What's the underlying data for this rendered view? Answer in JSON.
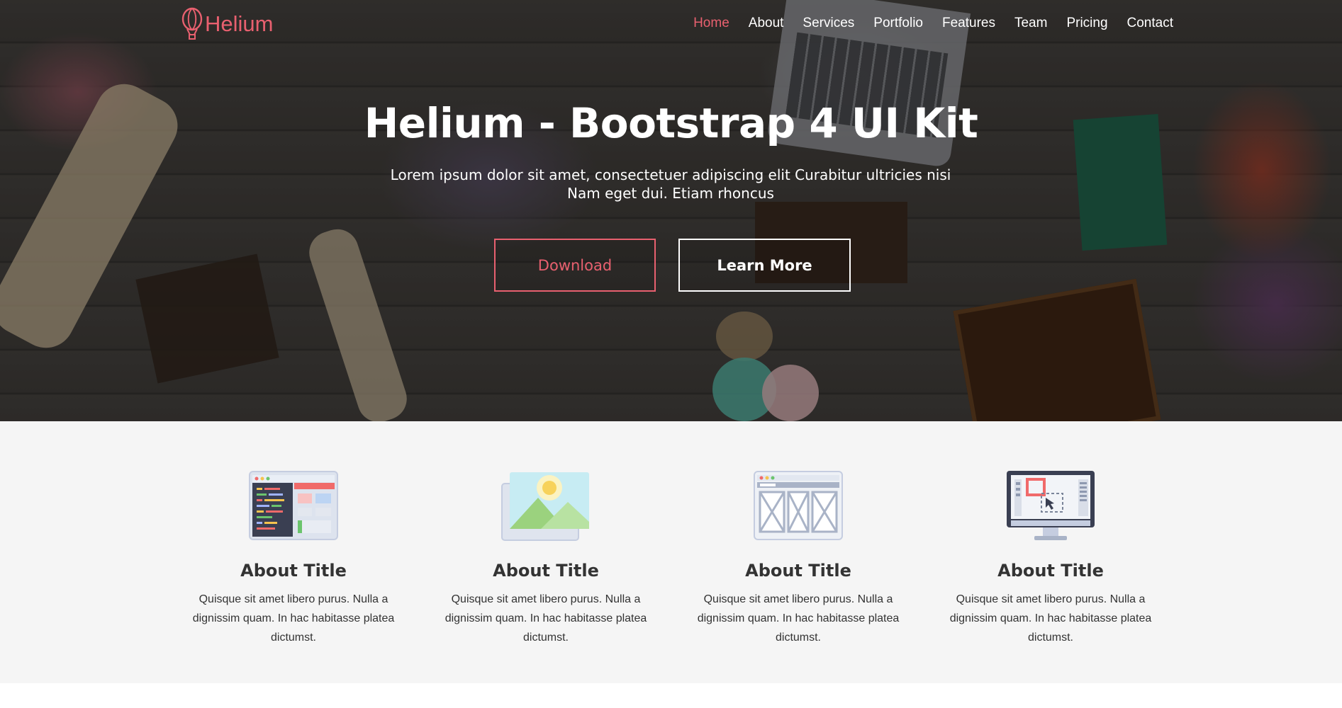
{
  "brand": {
    "name": "Helium"
  },
  "nav": {
    "items": [
      {
        "label": "Home",
        "active": true
      },
      {
        "label": "About"
      },
      {
        "label": "Services"
      },
      {
        "label": "Portfolio"
      },
      {
        "label": "Features"
      },
      {
        "label": "Team"
      },
      {
        "label": "Pricing"
      },
      {
        "label": "Contact"
      }
    ]
  },
  "hero": {
    "title": "Helium - Bootstrap 4 UI Kit",
    "subtitle": "Lorem ipsum dolor sit amet, consectetuer adipiscing elit Curabitur ultricies nisi Nam eget dui. Etiam rhoncus",
    "download_label": "Download",
    "learn_more_label": "Learn More"
  },
  "about": {
    "cards": [
      {
        "icon": "code-editor-icon",
        "title": "About Title",
        "text": "Quisque sit amet libero purus. Nulla a dignissim quam. In hac habitasse platea dictumst."
      },
      {
        "icon": "image-landscape-icon",
        "title": "About Title",
        "text": "Quisque sit amet libero purus. Nulla a dignissim quam. In hac habitasse platea dictumst."
      },
      {
        "icon": "wireframe-layout-icon",
        "title": "About Title",
        "text": "Quisque sit amet libero purus. Nulla a dignissim quam. In hac habitasse platea dictumst."
      },
      {
        "icon": "monitor-design-icon",
        "title": "About Title",
        "text": "Quisque sit amet libero purus. Nulla a dignissim quam. In hac habitasse platea dictumst."
      }
    ]
  },
  "colors": {
    "accent": "#e8606f",
    "section_bg": "#f5f5f5",
    "text_dark": "#333333"
  }
}
